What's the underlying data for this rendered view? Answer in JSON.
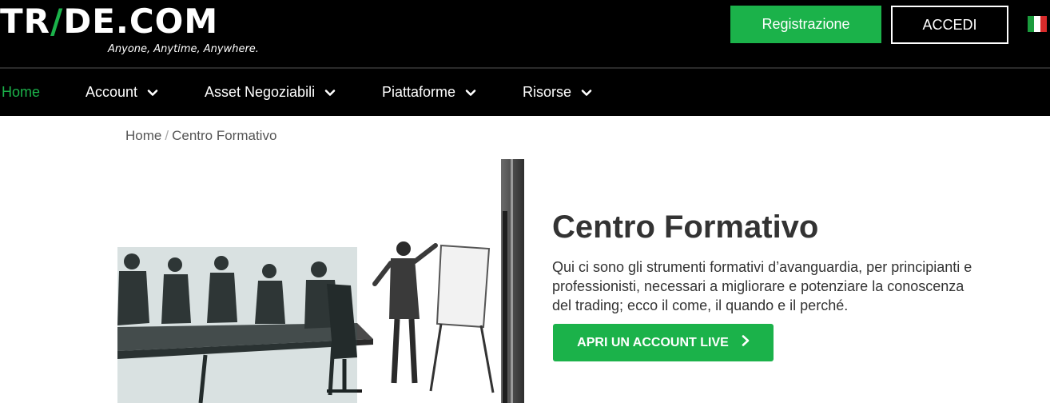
{
  "header": {
    "logo_text": "TRADE.COM",
    "tagline": "Anyone, Anytime, Anywhere.",
    "register_label": "Registrazione",
    "login_label": "ACCEDI",
    "language_flag_icon": "italy-flag-icon",
    "colors": {
      "brand_green": "#1bb24a",
      "header_bg": "#000000"
    }
  },
  "nav": {
    "items": [
      {
        "label": "Home",
        "active": true,
        "has_dropdown": false
      },
      {
        "label": "Account",
        "active": false,
        "has_dropdown": true
      },
      {
        "label": "Asset Negoziabili",
        "active": false,
        "has_dropdown": true
      },
      {
        "label": "Piattaforme",
        "active": false,
        "has_dropdown": true
      },
      {
        "label": "Risorse",
        "active": false,
        "has_dropdown": true
      }
    ]
  },
  "breadcrumb": {
    "home": "Home",
    "separator": "/",
    "current": "Centro Formativo"
  },
  "hero": {
    "title": "Centro Formativo",
    "description": "Qui ci sono gli strumenti formativi d’avanguardia, per principianti e professionisti, necessari a migliorare e potenziare la conoscenza del trading; ecco il come, il quando e il perché.",
    "cta_label": "APRI UN ACCOUNT LIVE",
    "image_icon": "business-meeting-photo"
  }
}
